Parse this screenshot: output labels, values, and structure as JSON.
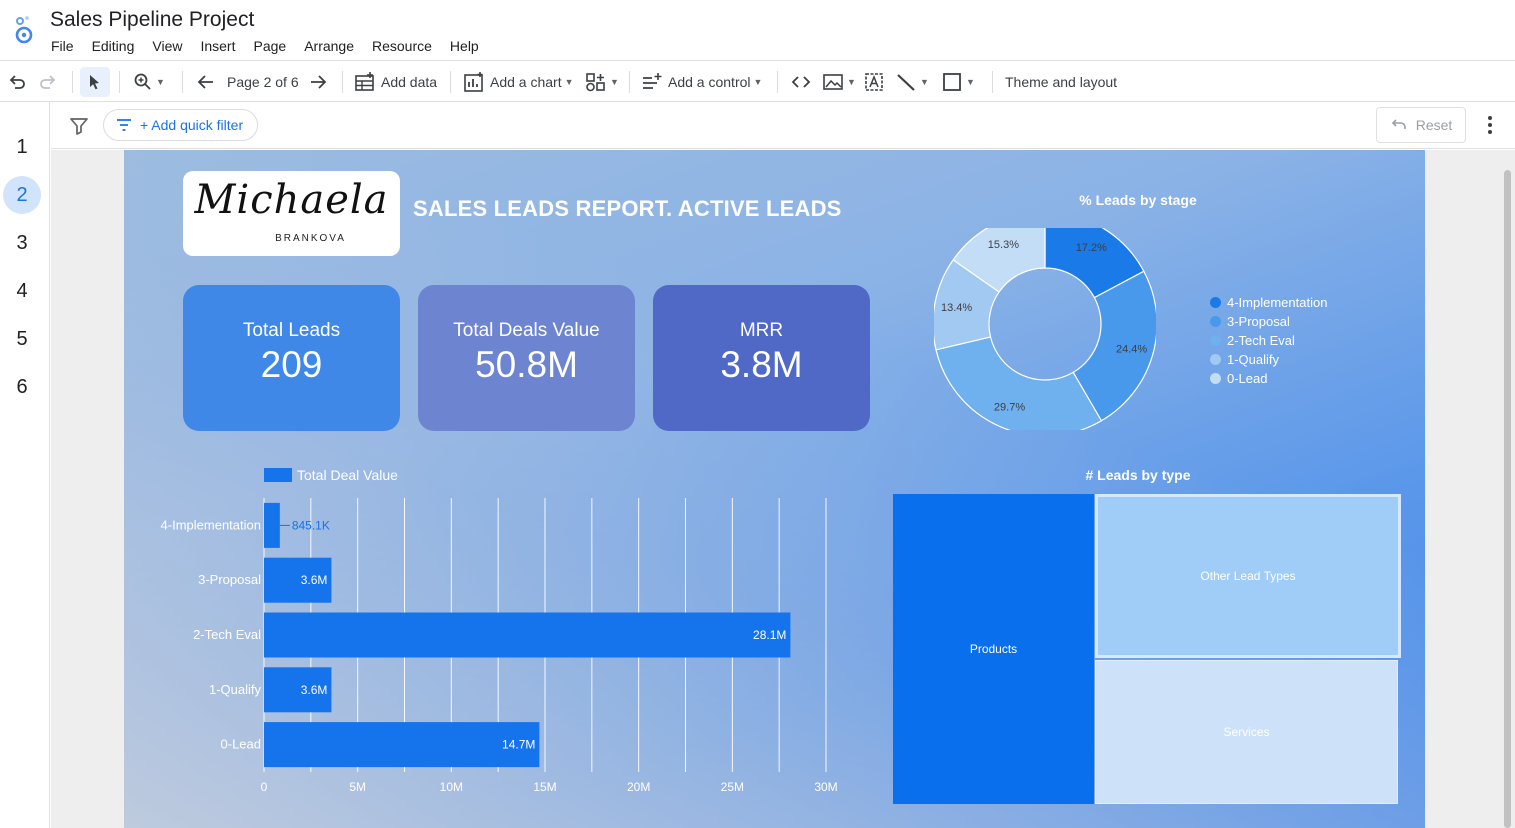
{
  "app": {
    "title": "Sales Pipeline Project"
  },
  "menu": [
    "File",
    "Editing",
    "View",
    "Insert",
    "Page",
    "Arrange",
    "Resource",
    "Help"
  ],
  "toolbar": {
    "page_indicator": "Page 2 of 6",
    "add_data": "Add data",
    "add_chart": "Add a chart",
    "add_control": "Add a control",
    "theme_layout": "Theme and layout"
  },
  "filterbar": {
    "quick_filter": "+ Add quick filter",
    "reset": "Reset"
  },
  "pages": [
    "1",
    "2",
    "3",
    "4",
    "5",
    "6"
  ],
  "active_page": "2",
  "report": {
    "logo_script": "Michaela",
    "logo_sub": "BRANKOVA",
    "title": "SALES LEADS REPORT. ACTIVE LEADS",
    "kpis": [
      {
        "label": "Total Leads",
        "value": "209"
      },
      {
        "label": "Total Deals Value",
        "value": "50.8M"
      },
      {
        "label": "MRR",
        "value": "3.8M"
      }
    ],
    "colors": {
      "accent": "#1a73e8",
      "bar": "#1573ec",
      "kpi1": "#3f88e8",
      "kpi2": "#6d84d0",
      "kpi3": "#5068c6"
    }
  },
  "chart_data": [
    {
      "type": "pie",
      "title": "% Leads by stage",
      "labels": [
        "4-Implementation",
        "3-Proposal",
        "2-Tech Eval",
        "1-Qualify",
        "0-Lead"
      ],
      "values": [
        17.2,
        24.4,
        29.7,
        13.4,
        15.3
      ],
      "value_labels": [
        "17.2%",
        "24.4%",
        "29.7%",
        "13.4%",
        "15.3%"
      ],
      "colors": [
        "#1a7ae8",
        "#4898ec",
        "#6fb0ee",
        "#a2c9f2",
        "#c4ddf7"
      ],
      "legend_position": "right"
    },
    {
      "type": "bar",
      "orientation": "horizontal",
      "categories": [
        "4-Implementation",
        "3-Proposal",
        "2-Tech Eval",
        "1-Qualify",
        "0-Lead"
      ],
      "series": [
        {
          "name": "Total Deal Value",
          "values": [
            845100,
            3600000,
            28100000,
            3600000,
            14700000
          ]
        }
      ],
      "value_labels": [
        "845.1K",
        "3.6M",
        "28.1M",
        "3.6M",
        "14.7M"
      ],
      "xlim": [
        0,
        30000000
      ],
      "x_ticks": [
        "0",
        "5M",
        "10M",
        "15M",
        "20M",
        "25M",
        "30M"
      ],
      "grid": true,
      "legend_position": "top-left"
    },
    {
      "type": "treemap",
      "title": "# Leads by type",
      "labels": [
        "Products",
        "Other Lead Types",
        "Services"
      ]
    }
  ]
}
